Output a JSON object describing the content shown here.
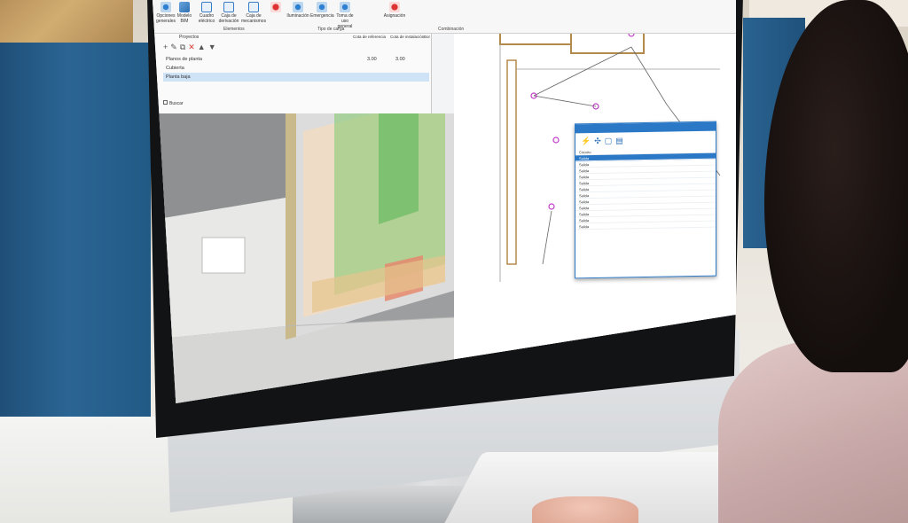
{
  "ribbon": {
    "buttons": [
      {
        "label": "Opciones generales",
        "icon": "settings-icon"
      },
      {
        "label": "Modelo BIM",
        "icon": "bim-model-icon"
      },
      {
        "label": "Cuadro eléctrico",
        "icon": "electrical-panel-icon"
      },
      {
        "label": "Caja de derivación",
        "icon": "junction-box-icon"
      },
      {
        "label": "Caja de mecanismos",
        "icon": "mechanism-box-icon"
      },
      {
        "label": "Iluminación",
        "icon": "lighting-icon"
      },
      {
        "label": "Emergencia",
        "icon": "emergency-icon"
      },
      {
        "label": "Toma de uso general",
        "icon": "socket-icon"
      },
      {
        "label": "Asignación",
        "icon": "assignment-icon"
      }
    ],
    "groups": {
      "elements": "Elementos",
      "load_types": "Tipo de carga",
      "combination": "Combinación"
    }
  },
  "projects_panel": {
    "title": "Proyectos",
    "columns": [
      "Cota de referencia",
      "Cota de instalación",
      "Bor"
    ],
    "rows": [
      {
        "name": "Planos de planta",
        "ref": "3.00",
        "inst": "3.00"
      },
      {
        "name": "Cubierta",
        "ref": "",
        "inst": ""
      },
      {
        "name": "Planta baja",
        "ref": "",
        "inst": ""
      }
    ],
    "search_label": "Buscar"
  },
  "dialog": {
    "rows": [
      "Circuito",
      "Salida",
      "Salida",
      "Salida",
      "Salida",
      "Salida",
      "Salida",
      "Salida",
      "Salida",
      "Salida",
      "Salida",
      "Salida",
      "Salida"
    ]
  },
  "colors": {
    "accent": "#2b78c6",
    "partition": "#2b6593",
    "green_zone": "#7fc86a",
    "orange_zone": "#e9b27e"
  }
}
